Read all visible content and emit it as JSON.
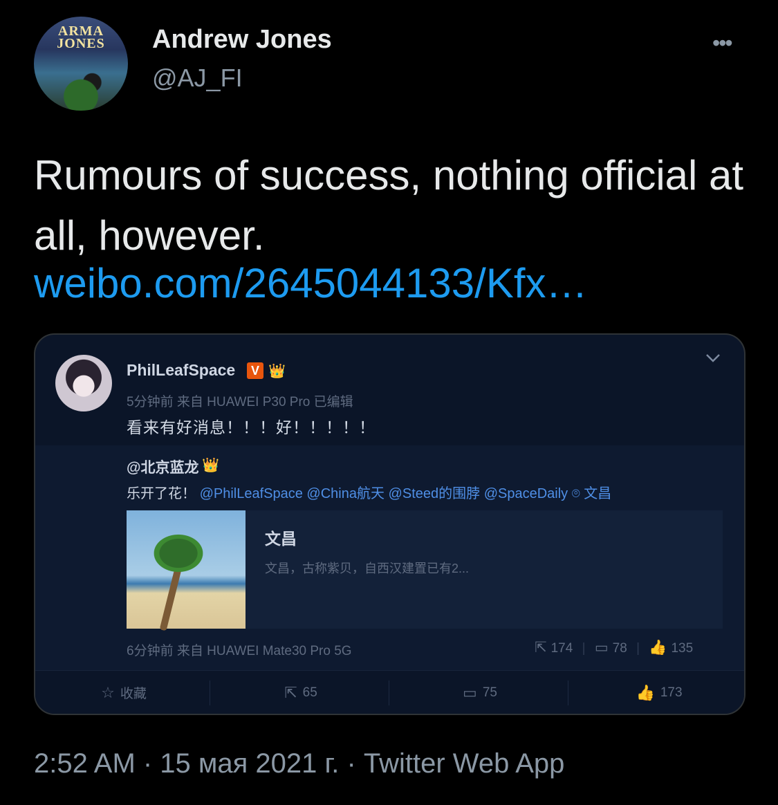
{
  "tweet": {
    "avatar_text_top": "ARMA",
    "avatar_text_bottom": "JONES",
    "display_name": "Andrew Jones",
    "handle": "@AJ_FI",
    "more_icon": "more-icon",
    "text": "Rumours of success, nothing official at all, however.",
    "link": "weibo.com/2645044133/Kfx…",
    "timestamp": "2:52 AM · 15 мая 2021 г. · Twitter Web App"
  },
  "embed": {
    "author": "PhilLeafSpace",
    "verified_badge": "V",
    "crown_badge": "👑",
    "meta": "5分钟前 来自 HUAWEI P30 Pro   已编辑",
    "text": "看来有好消息！！！好！！！！！",
    "collapse_icon": "chevron-down-icon",
    "repost": {
      "author": "@北京蓝龙",
      "text_prefix": "乐开了花！",
      "mentions": [
        "@PhilLeafSpace",
        "@China航天",
        "@Steed的围脖",
        "@SpaceDaily"
      ],
      "location": "文昌",
      "place": {
        "title": "文昌",
        "description": "文昌，古称紫贝，自西汉建置已有2..."
      },
      "time": "6分钟前 来自 HUAWEI Mate30 Pro 5G",
      "stats": {
        "reposts": "174",
        "comments": "78",
        "likes": "135"
      }
    },
    "actions": {
      "favorite": "收藏",
      "repost": "65",
      "comment": "75",
      "like": "173"
    }
  }
}
